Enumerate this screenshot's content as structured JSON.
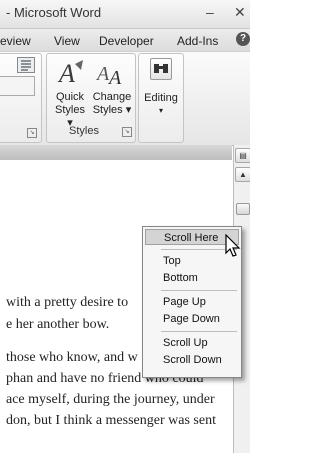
{
  "window": {
    "title": "- Microsoft Word",
    "minimize": "–",
    "close": "✕"
  },
  "tabs": [
    {
      "label": "eview"
    },
    {
      "label": "View"
    },
    {
      "label": "Developer"
    },
    {
      "label": "Add-Ins"
    }
  ],
  "help": "?",
  "ribbon": {
    "styles_group": {
      "label": "Styles",
      "quick_styles": [
        "Quick",
        "Styles ▾"
      ],
      "change_styles": [
        "Change",
        "Styles ▾"
      ]
    },
    "editing": {
      "label": "Editing",
      "arrow": "▾"
    }
  },
  "document": {
    "lines": [
      "with a pretty desire to",
      "e her another bow.",
      "",
      "those who know, and w",
      "phan and have no friend who could",
      "ace myself, during the journey, under",
      "don, but I think a messenger was sent"
    ]
  },
  "context_menu": {
    "items": [
      {
        "label": "Scroll Here",
        "highlighted": true
      },
      {
        "label": "Top"
      },
      {
        "label": "Bottom"
      },
      {
        "label": "Page Up"
      },
      {
        "label": "Page Down"
      },
      {
        "label": "Scroll Up"
      },
      {
        "label": "Scroll Down"
      }
    ]
  },
  "icons": {
    "binoculars": "binoculars-icon",
    "quick_styles": "quick-styles-icon",
    "change_styles": "change-styles-icon",
    "cursor": "arrow-cursor-icon"
  }
}
